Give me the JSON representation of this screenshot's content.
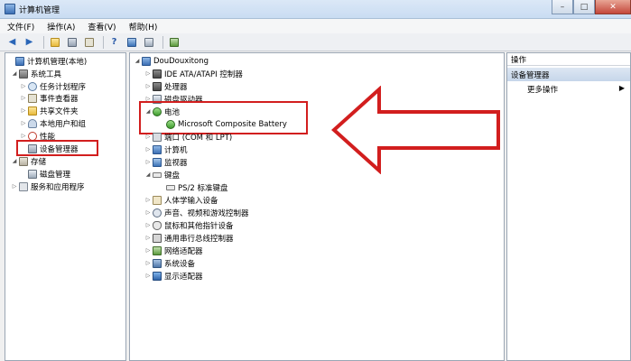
{
  "window": {
    "title": "计算机管理",
    "controls": {
      "minimize": "–",
      "maximize": "□",
      "close": "✕"
    }
  },
  "menu": [
    "文件(F)",
    "操作(A)",
    "查看(V)",
    "帮助(H)"
  ],
  "toolbar": {
    "icons": [
      "back-icon",
      "forward-icon",
      "up-icon",
      "show-hide-tree-icon",
      "properties-icon",
      "help-icon",
      "view-icon",
      "scan-icon",
      "update-driver-icon"
    ]
  },
  "left_tree": {
    "root": "计算机管理(本地)",
    "system_tools": "系统工具",
    "task_scheduler": "任务计划程序",
    "event_viewer": "事件查看器",
    "shared_folders": "共享文件夹",
    "local_users": "本地用户和组",
    "performance": "性能",
    "device_manager": "设备管理器",
    "storage": "存储",
    "disk_management": "磁盘管理",
    "services_apps": "服务和应用程序"
  },
  "device_tree": {
    "root": "DouDouxitong",
    "ide": "IDE ATA/ATAPI 控制器",
    "processor": "处理器",
    "disk_drives": "磁盘驱动器",
    "battery": "电池",
    "battery_child": "Microsoft Composite Battery",
    "ports": "端口 (COM 和 LPT)",
    "computer": "计算机",
    "monitor": "监视器",
    "keyboard": "键盘",
    "keyboard_child": "PS/2 标准键盘",
    "hid": "人体学输入设备",
    "sound": "声音、视频和游戏控制器",
    "mouse": "鼠标和其他指针设备",
    "usb": "通用串行总线控制器",
    "network": "网络适配器",
    "system_devices": "系统设备",
    "display": "显示适配器"
  },
  "actions": {
    "header": "操作",
    "section": "设备管理器",
    "more": "更多操作"
  },
  "colors": {
    "highlight": "#d21e1e"
  }
}
